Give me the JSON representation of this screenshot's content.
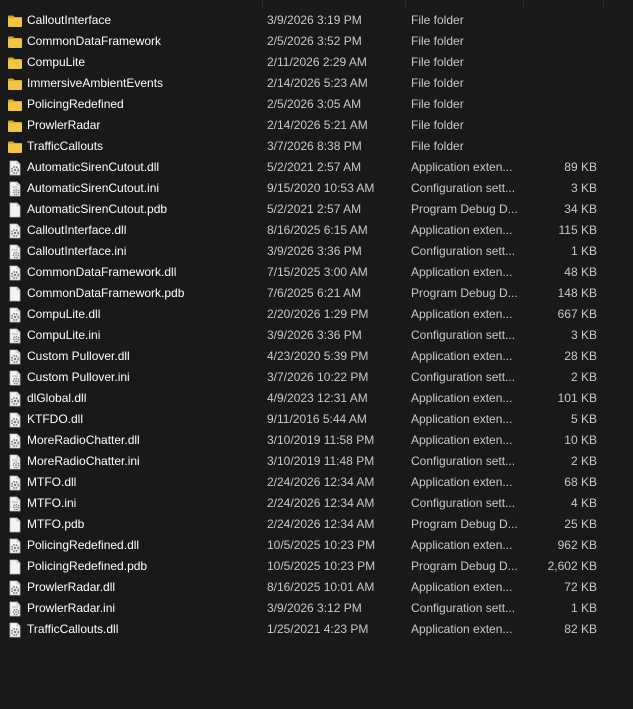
{
  "file_list": {
    "rows": [
      {
        "icon": "folder-icon",
        "name": "CalloutInterface",
        "date": "3/9/2026 3:19 PM",
        "type": "File folder",
        "size": ""
      },
      {
        "icon": "folder-icon",
        "name": "CommonDataFramework",
        "date": "2/5/2026 3:52 PM",
        "type": "File folder",
        "size": ""
      },
      {
        "icon": "folder-icon",
        "name": "CompuLite",
        "date": "2/11/2026 2:29 AM",
        "type": "File folder",
        "size": ""
      },
      {
        "icon": "folder-icon",
        "name": "ImmersiveAmbientEvents",
        "date": "2/14/2026 5:23 AM",
        "type": "File folder",
        "size": ""
      },
      {
        "icon": "folder-icon",
        "name": "PolicingRedefined",
        "date": "2/5/2026 3:05 AM",
        "type": "File folder",
        "size": ""
      },
      {
        "icon": "folder-icon",
        "name": "ProwlerRadar",
        "date": "2/14/2026 5:21 AM",
        "type": "File folder",
        "size": ""
      },
      {
        "icon": "folder-icon",
        "name": "TrafficCallouts",
        "date": "3/7/2026 8:38 PM",
        "type": "File folder",
        "size": ""
      },
      {
        "icon": "dll-file-icon",
        "name": "AutomaticSirenCutout.dll",
        "date": "5/2/2021 2:57 AM",
        "type": "Application exten...",
        "size": "89 KB"
      },
      {
        "icon": "ini-file-icon",
        "name": "AutomaticSirenCutout.ini",
        "date": "9/15/2020 10:53 AM",
        "type": "Configuration sett...",
        "size": "3 KB"
      },
      {
        "icon": "pdb-file-icon",
        "name": "AutomaticSirenCutout.pdb",
        "date": "5/2/2021 2:57 AM",
        "type": "Program Debug D...",
        "size": "34 KB"
      },
      {
        "icon": "dll-file-icon",
        "name": "CalloutInterface.dll",
        "date": "8/16/2025 6:15 AM",
        "type": "Application exten...",
        "size": "115 KB"
      },
      {
        "icon": "ini-file-icon",
        "name": "CalloutInterface.ini",
        "date": "3/9/2026 3:36 PM",
        "type": "Configuration sett...",
        "size": "1 KB"
      },
      {
        "icon": "dll-file-icon",
        "name": "CommonDataFramework.dll",
        "date": "7/15/2025 3:00 AM",
        "type": "Application exten...",
        "size": "48 KB"
      },
      {
        "icon": "pdb-file-icon",
        "name": "CommonDataFramework.pdb",
        "date": "7/6/2025 6:21 AM",
        "type": "Program Debug D...",
        "size": "148 KB"
      },
      {
        "icon": "dll-file-icon",
        "name": "CompuLite.dll",
        "date": "2/20/2026 1:29 PM",
        "type": "Application exten...",
        "size": "667 KB"
      },
      {
        "icon": "ini-file-icon",
        "name": "CompuLite.ini",
        "date": "3/9/2026 3:36 PM",
        "type": "Configuration sett...",
        "size": "3 KB"
      },
      {
        "icon": "dll-file-icon",
        "name": "Custom Pullover.dll",
        "date": "4/23/2020 5:39 PM",
        "type": "Application exten...",
        "size": "28 KB"
      },
      {
        "icon": "ini-file-icon",
        "name": "Custom Pullover.ini",
        "date": "3/7/2026 10:22 PM",
        "type": "Configuration sett...",
        "size": "2 KB"
      },
      {
        "icon": "dll-file-icon",
        "name": "dlGlobal.dll",
        "date": "4/9/2023 12:31 AM",
        "type": "Application exten...",
        "size": "101 KB"
      },
      {
        "icon": "dll-file-icon",
        "name": "KTFDO.dll",
        "date": "9/11/2016 5:44 AM",
        "type": "Application exten...",
        "size": "5 KB"
      },
      {
        "icon": "dll-file-icon",
        "name": "MoreRadioChatter.dll",
        "date": "3/10/2019 11:58 PM",
        "type": "Application exten...",
        "size": "10 KB"
      },
      {
        "icon": "ini-file-icon",
        "name": "MoreRadioChatter.ini",
        "date": "3/10/2019 11:48 PM",
        "type": "Configuration sett...",
        "size": "2 KB"
      },
      {
        "icon": "dll-file-icon",
        "name": "MTFO.dll",
        "date": "2/24/2026 12:34 AM",
        "type": "Application exten...",
        "size": "68 KB"
      },
      {
        "icon": "ini-file-icon",
        "name": "MTFO.ini",
        "date": "2/24/2026 12:34 AM",
        "type": "Configuration sett...",
        "size": "4 KB"
      },
      {
        "icon": "pdb-file-icon",
        "name": "MTFO.pdb",
        "date": "2/24/2026 12:34 AM",
        "type": "Program Debug D...",
        "size": "25 KB"
      },
      {
        "icon": "dll-file-icon",
        "name": "PolicingRedefined.dll",
        "date": "10/5/2025 10:23 PM",
        "type": "Application exten...",
        "size": "962 KB"
      },
      {
        "icon": "pdb-file-icon",
        "name": "PolicingRedefined.pdb",
        "date": "10/5/2025 10:23 PM",
        "type": "Program Debug D...",
        "size": "2,602 KB"
      },
      {
        "icon": "dll-file-icon",
        "name": "ProwlerRadar.dll",
        "date": "8/16/2025 10:01 AM",
        "type": "Application exten...",
        "size": "72 KB"
      },
      {
        "icon": "ini-file-icon",
        "name": "ProwlerRadar.ini",
        "date": "3/9/2026 3:12 PM",
        "type": "Configuration sett...",
        "size": "1 KB"
      },
      {
        "icon": "dll-file-icon",
        "name": "TrafficCallouts.dll",
        "date": "1/25/2021 4:23 PM",
        "type": "Application exten...",
        "size": "82 KB"
      }
    ]
  },
  "colors": {
    "background": "#191919",
    "folder": "#f1c546",
    "folder_back": "#d9a72c",
    "file_page": "#f4f4f4",
    "gear": "#6e7f92"
  }
}
